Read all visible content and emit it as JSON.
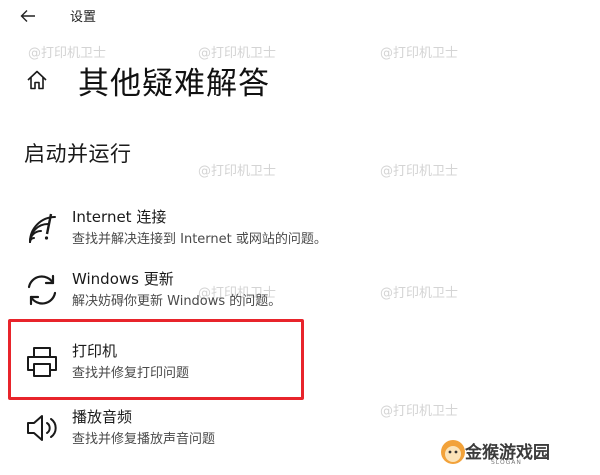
{
  "header": {
    "title": "设置"
  },
  "page": {
    "title": "其他疑难解答"
  },
  "section": {
    "title": "启动并运行"
  },
  "items": [
    {
      "title": "Internet 连接",
      "desc": "查找并解决连接到 Internet 或网站的问题。",
      "icon": "wifi-icon"
    },
    {
      "title": "Windows 更新",
      "desc": "解决妨碍你更新 Windows 的问题。",
      "icon": "refresh-icon"
    },
    {
      "title": "打印机",
      "desc": "查找并修复打印问题",
      "icon": "printer-icon"
    },
    {
      "title": "播放音频",
      "desc": "查找并修复播放声音问题",
      "icon": "speaker-icon"
    }
  ],
  "watermark": {
    "text": "@打印机卫士"
  },
  "logo": {
    "text": "金猴游戏园",
    "sub": "SLOGAN"
  },
  "colors": {
    "highlight": "#e8242b"
  }
}
